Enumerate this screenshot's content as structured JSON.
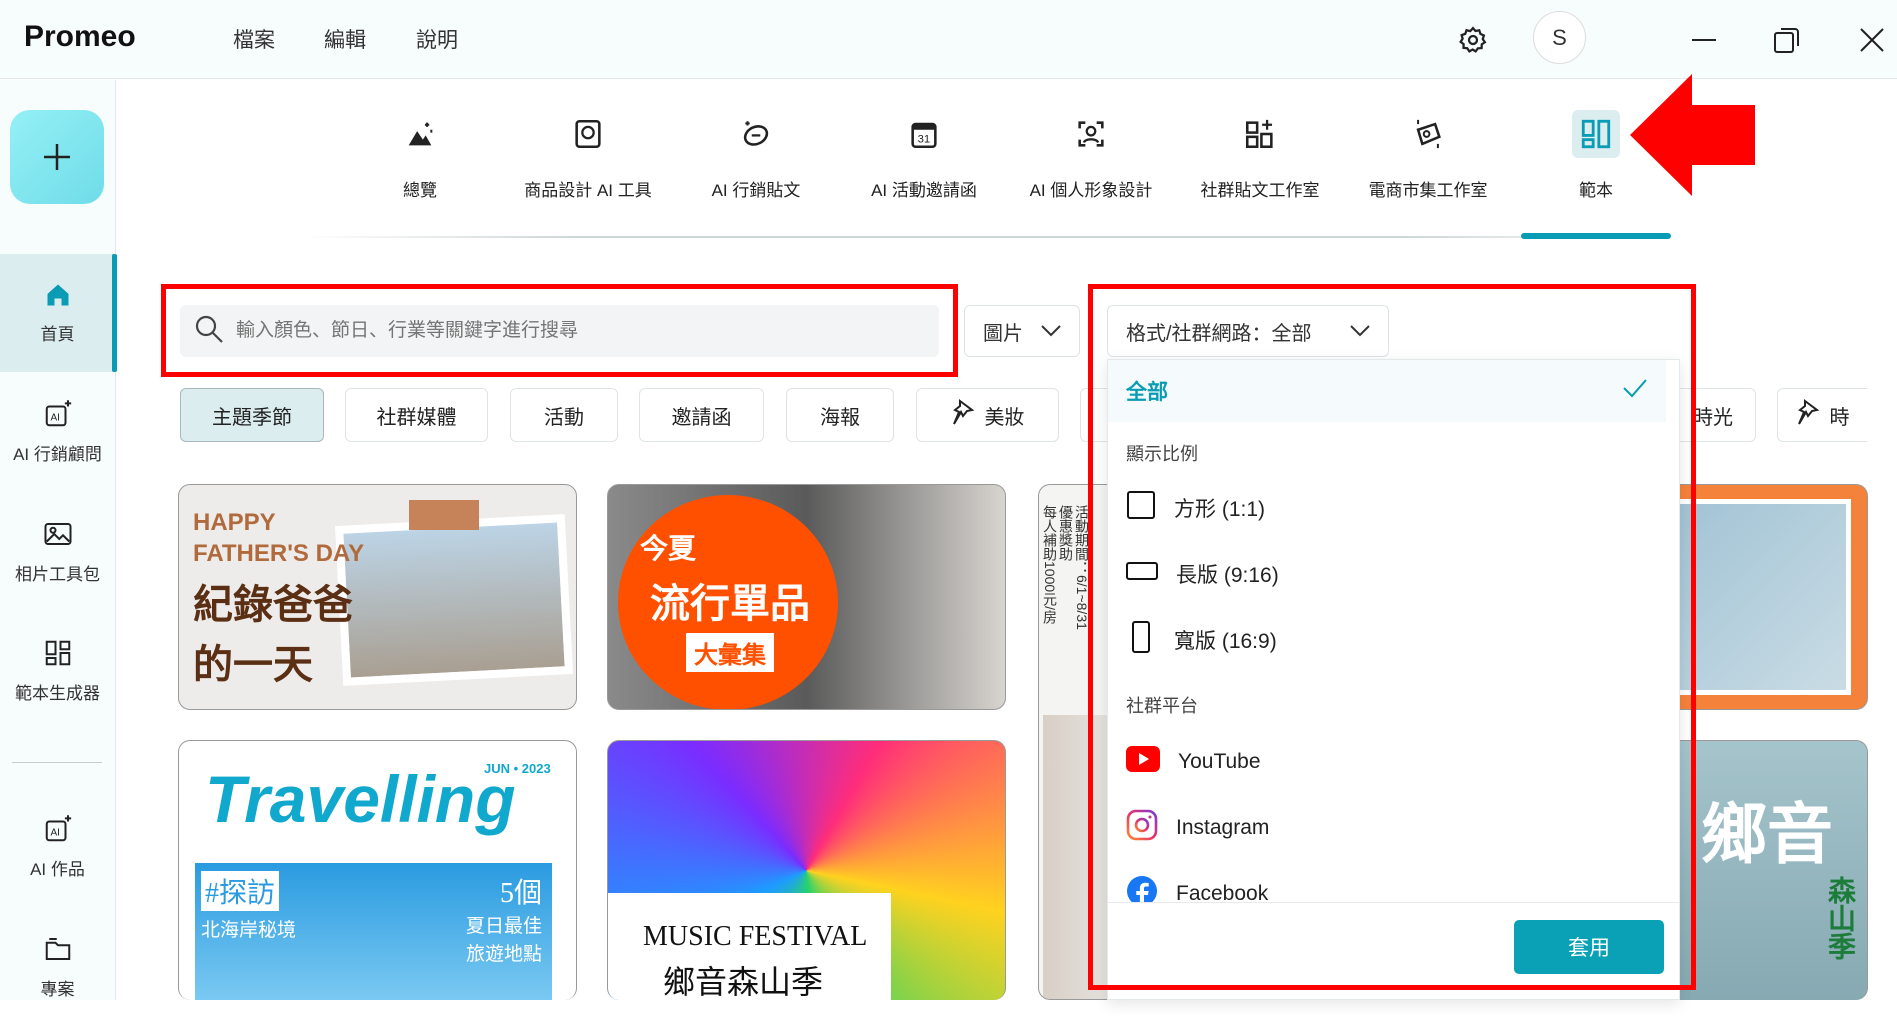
{
  "app": {
    "title": "Promeo",
    "menu": [
      "檔案",
      "編輯",
      "說明"
    ],
    "avatar_initial": "S"
  },
  "sidebar": {
    "items": [
      {
        "label": "首頁",
        "icon": "home-icon",
        "active": true
      },
      {
        "label": "AI 行銷顧問",
        "icon": "ai-sparkle-icon"
      },
      {
        "label": "相片工具包",
        "icon": "image-icon"
      },
      {
        "label": "範本生成器",
        "icon": "grid-icon"
      },
      {
        "label": "AI 作品",
        "icon": "ai-sparkle-icon"
      },
      {
        "label": "專案",
        "icon": "folder-icon"
      }
    ]
  },
  "nav": {
    "items": [
      {
        "label": "總覽",
        "icon": "overview-icon"
      },
      {
        "label": "商品設計 AI 工具",
        "icon": "product-design-icon"
      },
      {
        "label": "AI 行銷貼文",
        "icon": "marketing-post-icon"
      },
      {
        "label": "AI 活動邀請函",
        "icon": "calendar-icon",
        "day": "31"
      },
      {
        "label": "AI 個人形象設計",
        "icon": "portrait-icon"
      },
      {
        "label": "社群貼文工作室",
        "icon": "social-studio-icon"
      },
      {
        "label": "電商市集工作室",
        "icon": "ecommerce-icon"
      },
      {
        "label": "範本",
        "icon": "template-icon",
        "active": true
      }
    ]
  },
  "search": {
    "placeholder": "輸入顏色、節日、行業等關鍵字進行搜尋",
    "type_select": "圖片",
    "format_select": "格式/社群網路：全部"
  },
  "chips": [
    {
      "label": "主題季節",
      "active": true
    },
    {
      "label": "社群媒體"
    },
    {
      "label": "活動"
    },
    {
      "label": "邀請函"
    },
    {
      "label": "海報"
    },
    {
      "label": "美妝",
      "pin": true
    },
    {
      "label": "時光"
    },
    {
      "label": "時",
      "pin": true
    }
  ],
  "dropdown": {
    "selected": "全部",
    "section_ratio": "顯示比例",
    "ratios": [
      "方形 (1:1)",
      "長版 (9:16)",
      "寬版 (16:9)"
    ],
    "section_platform": "社群平台",
    "platforms": [
      "YouTube",
      "Instagram",
      "Facebook"
    ],
    "apply": "套用"
  },
  "cards": {
    "c1": {
      "l1": "HAPPY",
      "l2": "FATHER'S DAY",
      "l3": "紀錄爸爸",
      "l4": "的一天"
    },
    "c2": {
      "l1": "今夏",
      "l2": "流行單品",
      "l3": "大彙集"
    },
    "c3": {
      "l1": "活動期間：6/1~8/31",
      "l2": "每人補助1000元/房",
      "l3": "優惠獎助"
    },
    "c4": {
      "l1": "Travelling",
      "l2": "JUN • 2023",
      "l3": "#探訪",
      "l4": "北海岸秘境",
      "l5": "5個",
      "l6": "夏日最佳",
      "l7": "旅遊地點"
    },
    "c5": {
      "l1": "MUSIC FESTIVAL",
      "l2": "鄉音森山季"
    },
    "c6": {
      "l1": "鄉音",
      "l2": "森山季"
    }
  },
  "colors": {
    "accent": "#0b9cb5",
    "highlight": "#ff0000"
  }
}
